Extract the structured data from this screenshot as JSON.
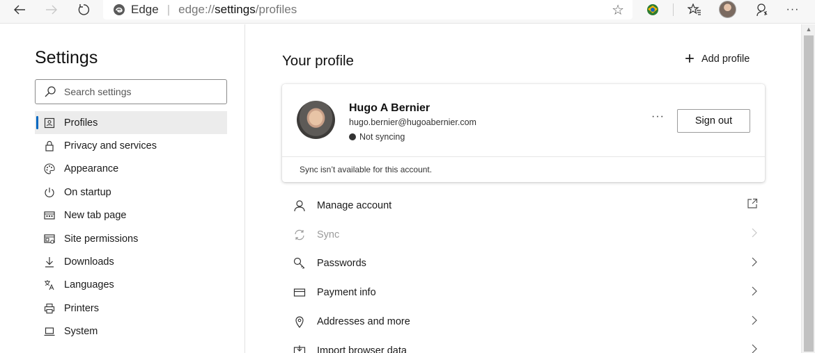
{
  "toolbar": {
    "brand": "Edge",
    "separator": "|",
    "url_prefix": "edge://",
    "url_main": "settings",
    "url_suffix": "/profiles",
    "icons": [
      "back-icon",
      "forward-icon",
      "refresh-icon",
      "favorite-star-icon",
      "extension-icon",
      "favorites-icon",
      "profile-avatar",
      "read-aloud-icon",
      "more-icon"
    ]
  },
  "sidebar": {
    "title": "Settings",
    "search_placeholder": "Search settings",
    "items": [
      {
        "label": "Profiles",
        "icon": "profile-card-icon",
        "active": true
      },
      {
        "label": "Privacy and services",
        "icon": "lock-icon"
      },
      {
        "label": "Appearance",
        "icon": "palette-icon"
      },
      {
        "label": "On startup",
        "icon": "power-icon"
      },
      {
        "label": "New tab page",
        "icon": "new-tab-icon"
      },
      {
        "label": "Site permissions",
        "icon": "site-permissions-icon"
      },
      {
        "label": "Downloads",
        "icon": "download-icon"
      },
      {
        "label": "Languages",
        "icon": "languages-icon"
      },
      {
        "label": "Printers",
        "icon": "printer-icon"
      },
      {
        "label": "System",
        "icon": "laptop-icon"
      }
    ]
  },
  "main": {
    "title": "Your profile",
    "add_profile": "Add profile",
    "profile": {
      "name": "Hugo A Bernier",
      "email": "hugo.bernier@hugoabernier.com",
      "sync_status": "Not syncing",
      "more": "···",
      "sign_out": "Sign out",
      "notice": "Sync isn’t available for this account."
    },
    "rows": [
      {
        "label": "Manage account",
        "icon": "person-icon",
        "trail": "external-link-icon"
      },
      {
        "label": "Sync",
        "icon": "sync-icon",
        "trail": "chevron-right-icon",
        "disabled": true
      },
      {
        "label": "Passwords",
        "icon": "key-icon",
        "trail": "chevron-right-icon"
      },
      {
        "label": "Payment info",
        "icon": "card-icon",
        "trail": "chevron-right-icon"
      },
      {
        "label": "Addresses and more",
        "icon": "location-pin-icon",
        "trail": "chevron-right-icon"
      },
      {
        "label": "Import browser data",
        "icon": "import-icon",
        "trail": "chevron-right-icon"
      }
    ]
  },
  "colors": {
    "accent": "#0067c0",
    "active_item_bg": "#ececec"
  }
}
